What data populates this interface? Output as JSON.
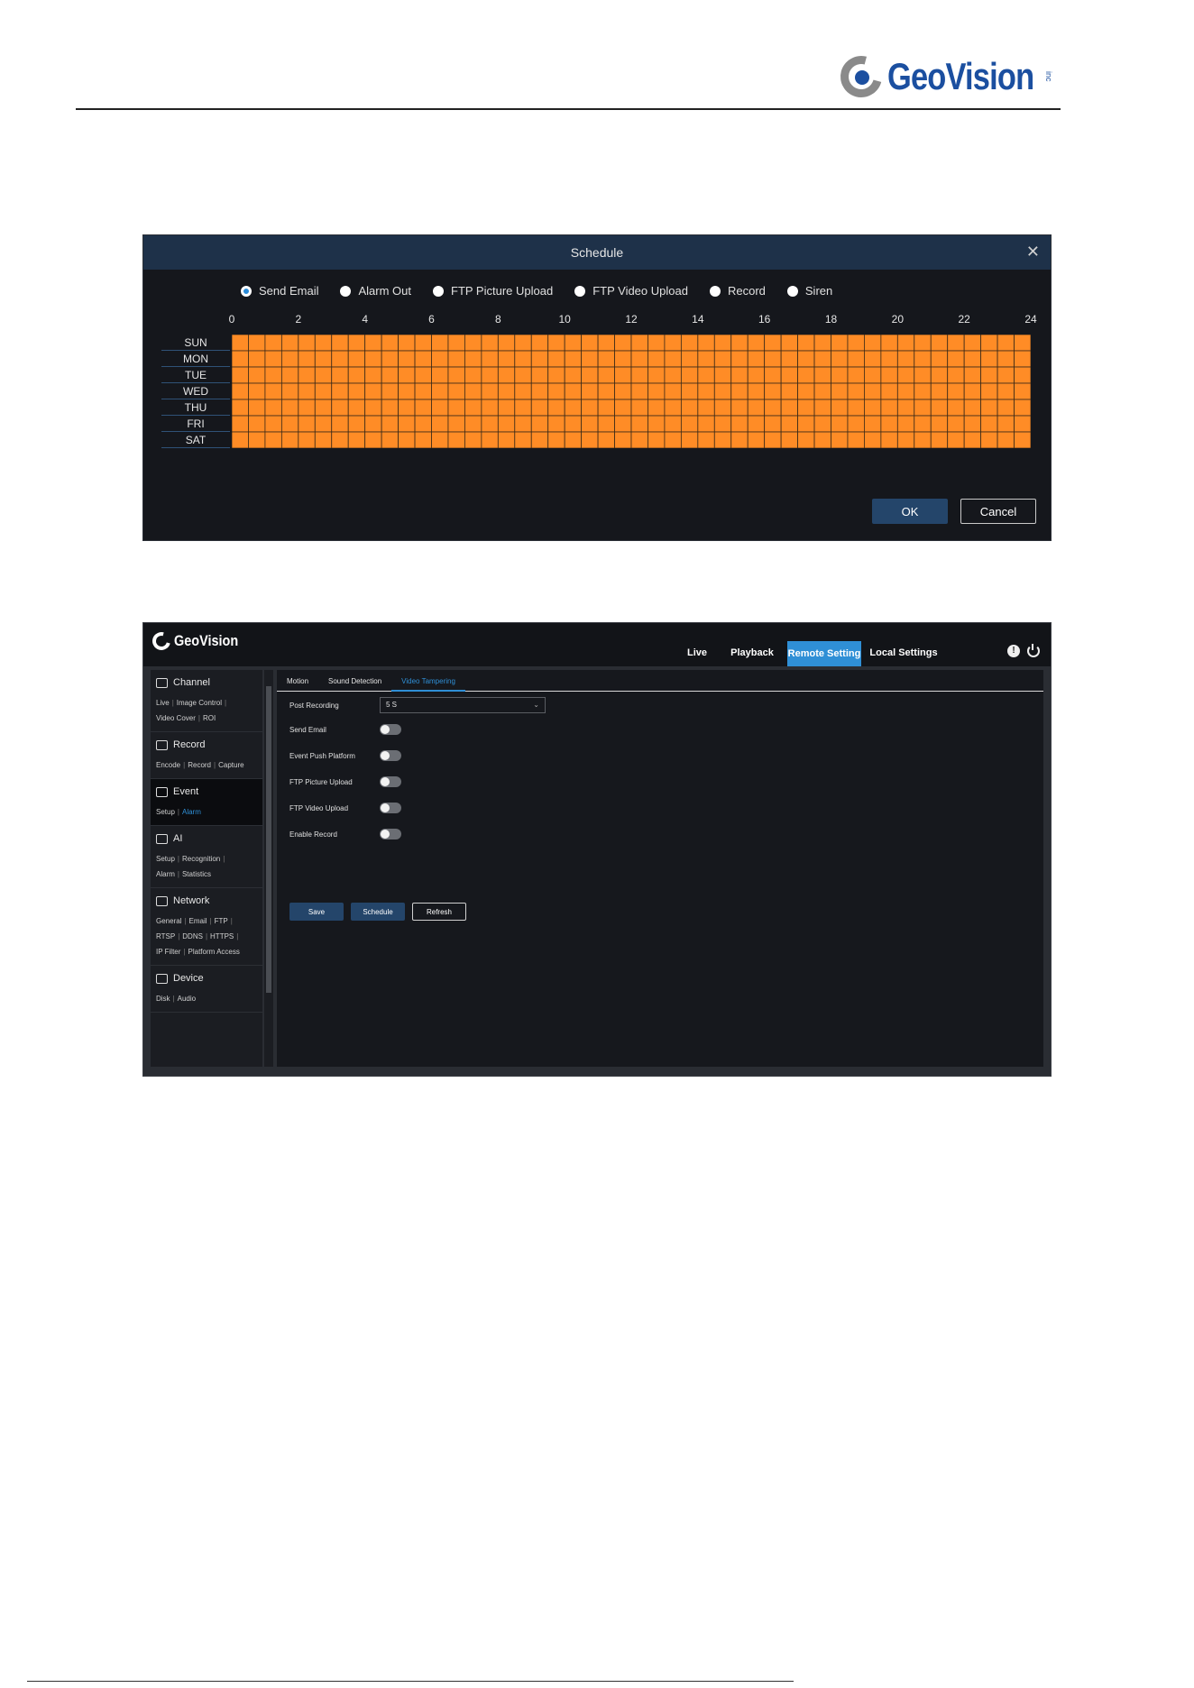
{
  "header": {
    "brand": "GeoVision",
    "brand_suffix": "inc"
  },
  "schedule_dialog": {
    "title": "Schedule",
    "close_glyph": "✕",
    "radio_options": [
      {
        "label": "Send Email",
        "selected": true
      },
      {
        "label": "Alarm Out",
        "selected": false
      },
      {
        "label": "FTP Picture Upload",
        "selected": false
      },
      {
        "label": "FTP Video Upload",
        "selected": false
      },
      {
        "label": "Record",
        "selected": false
      },
      {
        "label": "Siren",
        "selected": false
      }
    ],
    "hour_labels": [
      "0",
      "2",
      "4",
      "6",
      "8",
      "10",
      "12",
      "14",
      "16",
      "18",
      "20",
      "22",
      "24"
    ],
    "days": [
      "SUN",
      "MON",
      "TUE",
      "WED",
      "THU",
      "FRI",
      "SAT"
    ],
    "all_slots_scheduled": true,
    "slot_color": "#ff8c26",
    "ok_label": "OK",
    "cancel_label": "Cancel"
  },
  "settings_window": {
    "brand": "GeoVision",
    "nav": [
      {
        "label": "Live",
        "active": false
      },
      {
        "label": "Playback",
        "active": false
      },
      {
        "label": "Remote Setting",
        "active": true
      },
      {
        "label": "Local Settings",
        "active": false
      }
    ],
    "info_glyph": "!",
    "sidebar": [
      {
        "title": "Channel",
        "icon": "camera-icon",
        "links": [
          [
            "Live",
            "Image Control"
          ],
          [
            "Video Cover",
            "ROI"
          ]
        ]
      },
      {
        "title": "Record",
        "icon": "record-icon",
        "links": [
          [
            "Encode",
            "Record",
            "Capture"
          ]
        ]
      },
      {
        "title": "Event",
        "icon": "event-icon",
        "active": true,
        "links": [
          [
            "Setup",
            "Alarm"
          ]
        ],
        "current_link": "Alarm"
      },
      {
        "title": "AI",
        "icon": "ai-icon",
        "links": [
          [
            "Setup",
            "Recognition"
          ],
          [
            "Alarm",
            "Statistics"
          ]
        ]
      },
      {
        "title": "Network",
        "icon": "network-icon",
        "links": [
          [
            "General",
            "Email",
            "FTP"
          ],
          [
            "RTSP",
            "DDNS",
            "HTTPS"
          ],
          [
            "IP Filter",
            "Platform Access"
          ]
        ]
      },
      {
        "title": "Device",
        "icon": "device-icon",
        "links": [
          [
            "Disk",
            "Audio"
          ]
        ]
      }
    ],
    "tabs": [
      {
        "label": "Motion",
        "active": false
      },
      {
        "label": "Sound Detection",
        "active": false
      },
      {
        "label": "Video Tampering",
        "active": true
      }
    ],
    "fields": {
      "post_recording_label": "Post Recording",
      "post_recording_value": "5 S",
      "toggles": [
        {
          "label": "Send Email",
          "on": false
        },
        {
          "label": "Event Push Platform",
          "on": false
        },
        {
          "label": "FTP Picture Upload",
          "on": false
        },
        {
          "label": "FTP Video Upload",
          "on": false
        },
        {
          "label": "Enable Record",
          "on": false
        }
      ]
    },
    "buttons": {
      "save": "Save",
      "schedule": "Schedule",
      "refresh": "Refresh"
    }
  }
}
